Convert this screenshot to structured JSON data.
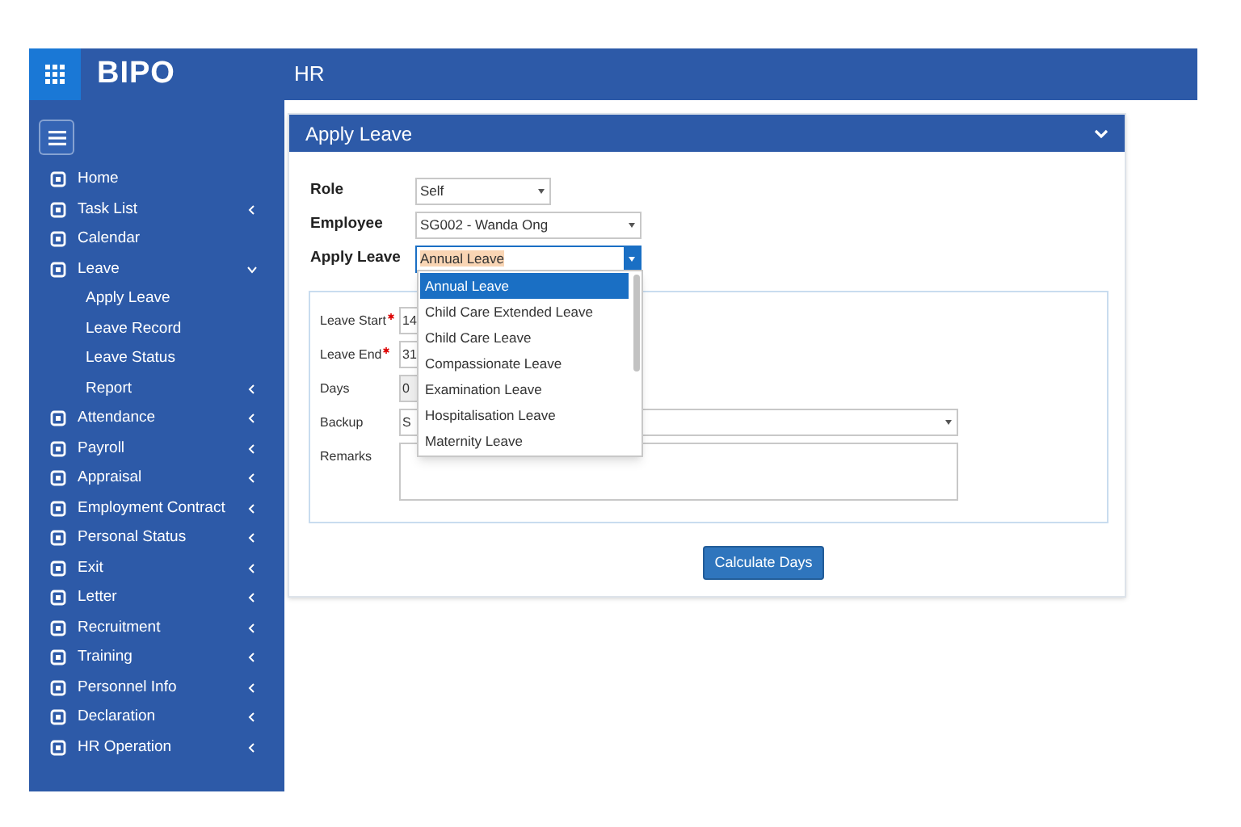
{
  "logo": "BIPO",
  "header": {
    "title": "HR"
  },
  "sidebar": {
    "items": [
      {
        "label": "Home",
        "kind": "link"
      },
      {
        "label": "Task List",
        "kind": "group",
        "expanded": false
      },
      {
        "label": "Calendar",
        "kind": "link"
      },
      {
        "label": "Leave",
        "kind": "group",
        "expanded": true,
        "children": [
          {
            "label": "Apply Leave",
            "kind": "link"
          },
          {
            "label": "Leave Record",
            "kind": "link"
          },
          {
            "label": "Leave Status",
            "kind": "link"
          },
          {
            "label": "Report",
            "kind": "group",
            "expanded": false
          }
        ]
      },
      {
        "label": "Attendance",
        "kind": "group",
        "expanded": false
      },
      {
        "label": "Payroll",
        "kind": "group",
        "expanded": false
      },
      {
        "label": "Appraisal",
        "kind": "group",
        "expanded": false
      },
      {
        "label": "Employment Contract",
        "kind": "group",
        "expanded": false
      },
      {
        "label": "Personal Status",
        "kind": "group",
        "expanded": false
      },
      {
        "label": "Exit",
        "kind": "group",
        "expanded": false
      },
      {
        "label": "Letter",
        "kind": "group",
        "expanded": false
      },
      {
        "label": "Recruitment",
        "kind": "group",
        "expanded": false
      },
      {
        "label": "Training",
        "kind": "group",
        "expanded": false
      },
      {
        "label": "Personnel Info",
        "kind": "group",
        "expanded": false
      },
      {
        "label": "Declaration",
        "kind": "group",
        "expanded": false
      },
      {
        "label": "HR Operation",
        "kind": "group",
        "expanded": false
      }
    ]
  },
  "panel": {
    "title": "Apply Leave",
    "top_fields": [
      {
        "label": "Role",
        "value": "Self",
        "open": false
      },
      {
        "label": "Employee",
        "value": "SG002 - Wanda Ong",
        "open": false
      },
      {
        "label": "Apply Leave",
        "value": "Annual Leave",
        "open": true
      }
    ],
    "dropdown_options": [
      {
        "label": "Annual Leave",
        "selected": true
      },
      {
        "label": "Child Care Extended Leave",
        "selected": false
      },
      {
        "label": "Child Care Leave",
        "selected": false
      },
      {
        "label": "Compassionate Leave",
        "selected": false
      },
      {
        "label": "Examination Leave",
        "selected": false
      },
      {
        "label": "Hospitalisation Leave",
        "selected": false
      },
      {
        "label": "Maternity Leave",
        "selected": false
      }
    ],
    "detail_fields": [
      {
        "label": "Leave Start",
        "required": true,
        "value": "14",
        "kind": "input"
      },
      {
        "label": "Leave End",
        "required": true,
        "value": "31",
        "kind": "input"
      },
      {
        "label": "Days",
        "required": false,
        "value": "0",
        "kind": "readonly"
      },
      {
        "label": "Backup",
        "required": false,
        "value": "S",
        "kind": "select"
      },
      {
        "label": "Remarks",
        "required": false,
        "kind": "textarea"
      }
    ],
    "button": "Calculate Days"
  }
}
